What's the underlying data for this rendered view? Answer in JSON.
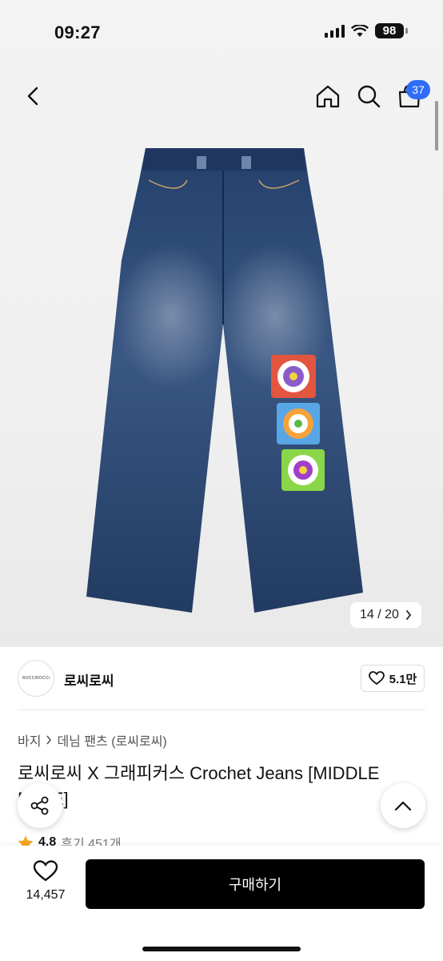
{
  "status_bar": {
    "time": "09:27",
    "battery": "98"
  },
  "nav": {
    "cart_count": "37"
  },
  "gallery": {
    "counter": "14 / 20"
  },
  "brand": {
    "logo_text": "ROCCIROCCI",
    "name": "로씨로씨",
    "likes": "5.1만"
  },
  "breadcrumb": {
    "category": "바지",
    "subcategory": "데님 팬츠 (로씨로씨)"
  },
  "product": {
    "title": "로씨로씨 X 그래피커스 Crochet Jeans [MIDDLE BLUE]",
    "rating": "4.8",
    "reviews": "후기 451개"
  },
  "bottom_bar": {
    "wish_count": "14,457",
    "buy_label": "구매하기"
  },
  "colors": {
    "accent": "#2f6df6",
    "denim": "#2c4670",
    "rating_star": "#f5a623"
  }
}
